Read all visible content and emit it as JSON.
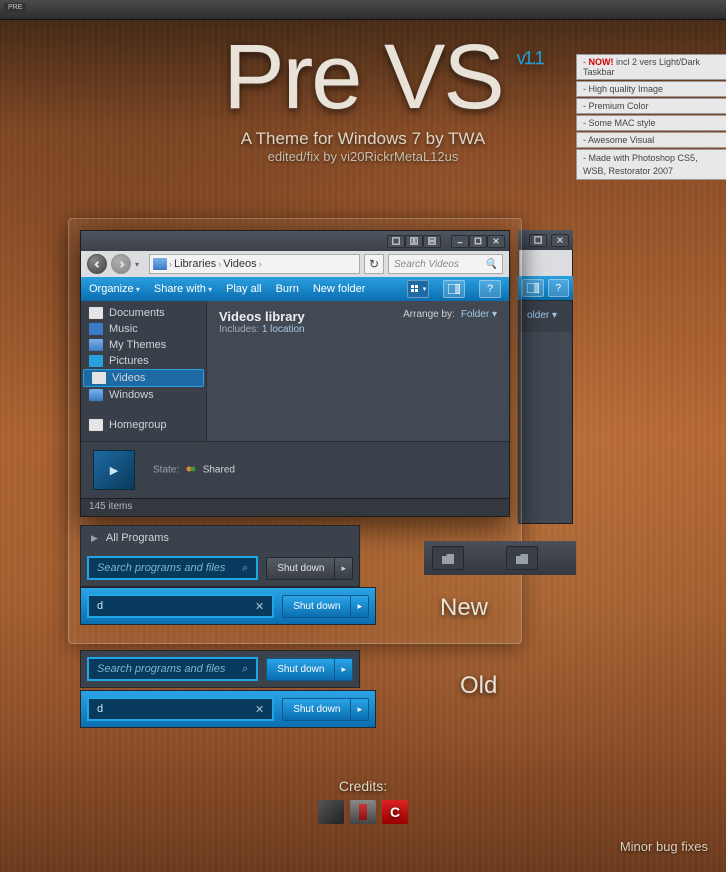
{
  "top_badge": "PRE",
  "title": {
    "main": "Pre VS",
    "version": "v1.1",
    "sub": "A Theme for Windows 7 by TWA",
    "edit": "edited/fix by vi20RickrMetaL12us"
  },
  "features": [
    {
      "bang": "NOW!",
      "text": " incl 2 vers Light/Dark Taskbar"
    },
    {
      "text": "High quality Image"
    },
    {
      "text": "Premium Color"
    },
    {
      "text": "Some MAC style"
    },
    {
      "text": "Awesome Visual"
    },
    {
      "text": "Made with Photoshop CS5, WSB, Restorator 2007"
    }
  ],
  "explorer": {
    "breadcrumb": {
      "root": "Libraries",
      "sep": "›",
      "current": "Videos"
    },
    "search_placeholder": "Search Videos",
    "toolbar": {
      "organize": "Organize",
      "sharewith": "Share with",
      "playall": "Play all",
      "burn": "Burn",
      "newfolder": "New folder"
    },
    "sidebar": {
      "items": [
        {
          "label": "Documents"
        },
        {
          "label": "Music"
        },
        {
          "label": "My Themes"
        },
        {
          "label": "Pictures"
        },
        {
          "label": "Videos"
        },
        {
          "label": "Windows"
        }
      ],
      "homegroup": "Homegroup"
    },
    "content": {
      "title": "Videos library",
      "includes_label": "Includes:",
      "includes_value": "1 location",
      "arrange_label": "Arrange by:",
      "arrange_value": "Folder"
    },
    "details": {
      "state_label": "State:",
      "state_value": "Shared"
    },
    "status": "145 items"
  },
  "back_arrange": "older",
  "start": {
    "all_programs": "All Programs",
    "search_placeholder": "Search programs and files",
    "search_value": "d",
    "shutdown": "Shut down"
  },
  "labels": {
    "new": "New",
    "old": "Old"
  },
  "credits": {
    "heading": "Credits:",
    "c_letter": "C"
  },
  "minor": "Minor bug fixes"
}
